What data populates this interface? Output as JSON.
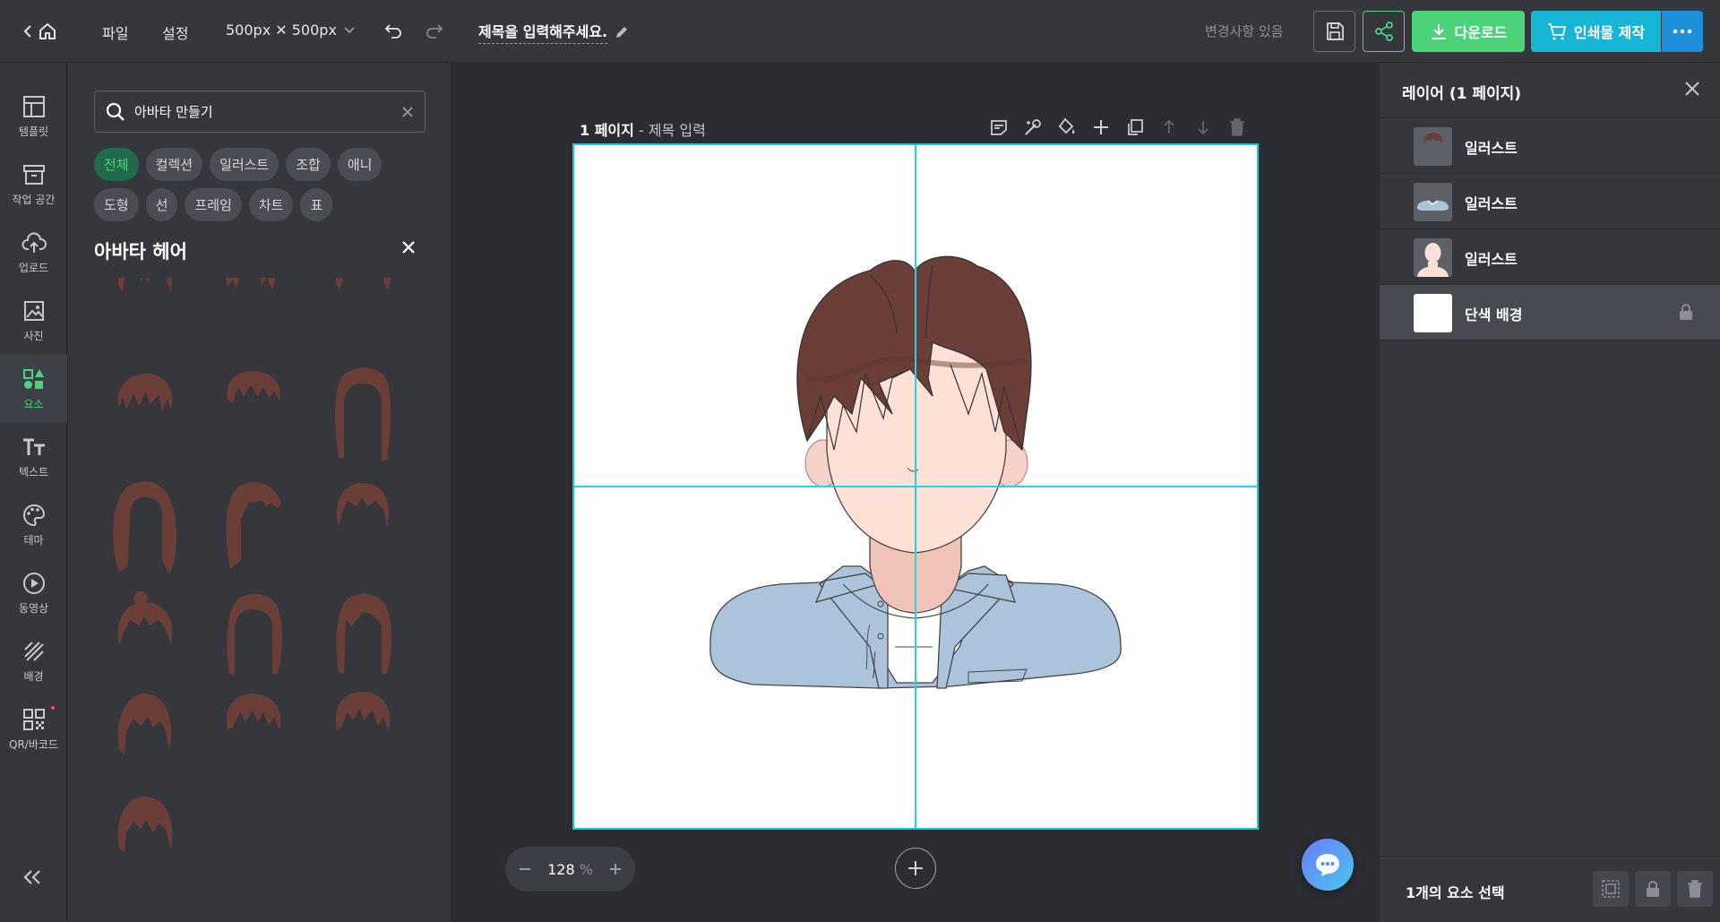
{
  "topbar": {
    "file_label": "파일",
    "settings_label": "설정",
    "size_label": "500px ✕ 500px",
    "doc_title": "제목을 입력해주세요.",
    "changes_status": "변경사항 있음",
    "download_label": "다운로드",
    "print_label": "인쇄물 제작"
  },
  "sidebar": {
    "items": [
      {
        "label": "템플릿",
        "icon": "layout-icon"
      },
      {
        "label": "작업 공간",
        "icon": "archive-icon"
      },
      {
        "label": "업로드",
        "icon": "cloud-upload-icon"
      },
      {
        "label": "사진",
        "icon": "image-icon"
      },
      {
        "label": "요소",
        "icon": "shapes-icon"
      },
      {
        "label": "텍스트",
        "icon": "text-icon"
      },
      {
        "label": "테마",
        "icon": "palette-icon"
      },
      {
        "label": "동영상",
        "icon": "play-icon"
      },
      {
        "label": "배경",
        "icon": "hatch-icon"
      },
      {
        "label": "QR/바코드",
        "icon": "qr-icon"
      }
    ],
    "active_index": 4
  },
  "panel": {
    "search_value": "아바타 만들기",
    "chips": [
      "전체",
      "컬렉션",
      "일러스트",
      "조합",
      "애니",
      "도형",
      "선",
      "프레임",
      "차트",
      "표"
    ],
    "active_chip": "전체",
    "section_title": "아바타 헤어"
  },
  "canvas": {
    "page_number": "1 페이지",
    "page_sep": " - ",
    "page_title_placeholder": "제목 입력",
    "zoom_value": "128",
    "zoom_unit": "%"
  },
  "layers": {
    "title": "레이어 (1 페이지)",
    "items": [
      {
        "name": "일러스트",
        "thumb": "hair"
      },
      {
        "name": "일러스트",
        "thumb": "shirt"
      },
      {
        "name": "일러스트",
        "thumb": "face"
      },
      {
        "name": "단색 배경",
        "thumb": "white",
        "locked": true
      }
    ],
    "selection_count": "1개의 요소 선택"
  },
  "colors": {
    "accent_green": "#4cd37a",
    "accent_cyan": "#18b6d6",
    "hair": "#6b3f38",
    "skin": "#fde0d6",
    "shirt": "#abc4dc"
  }
}
